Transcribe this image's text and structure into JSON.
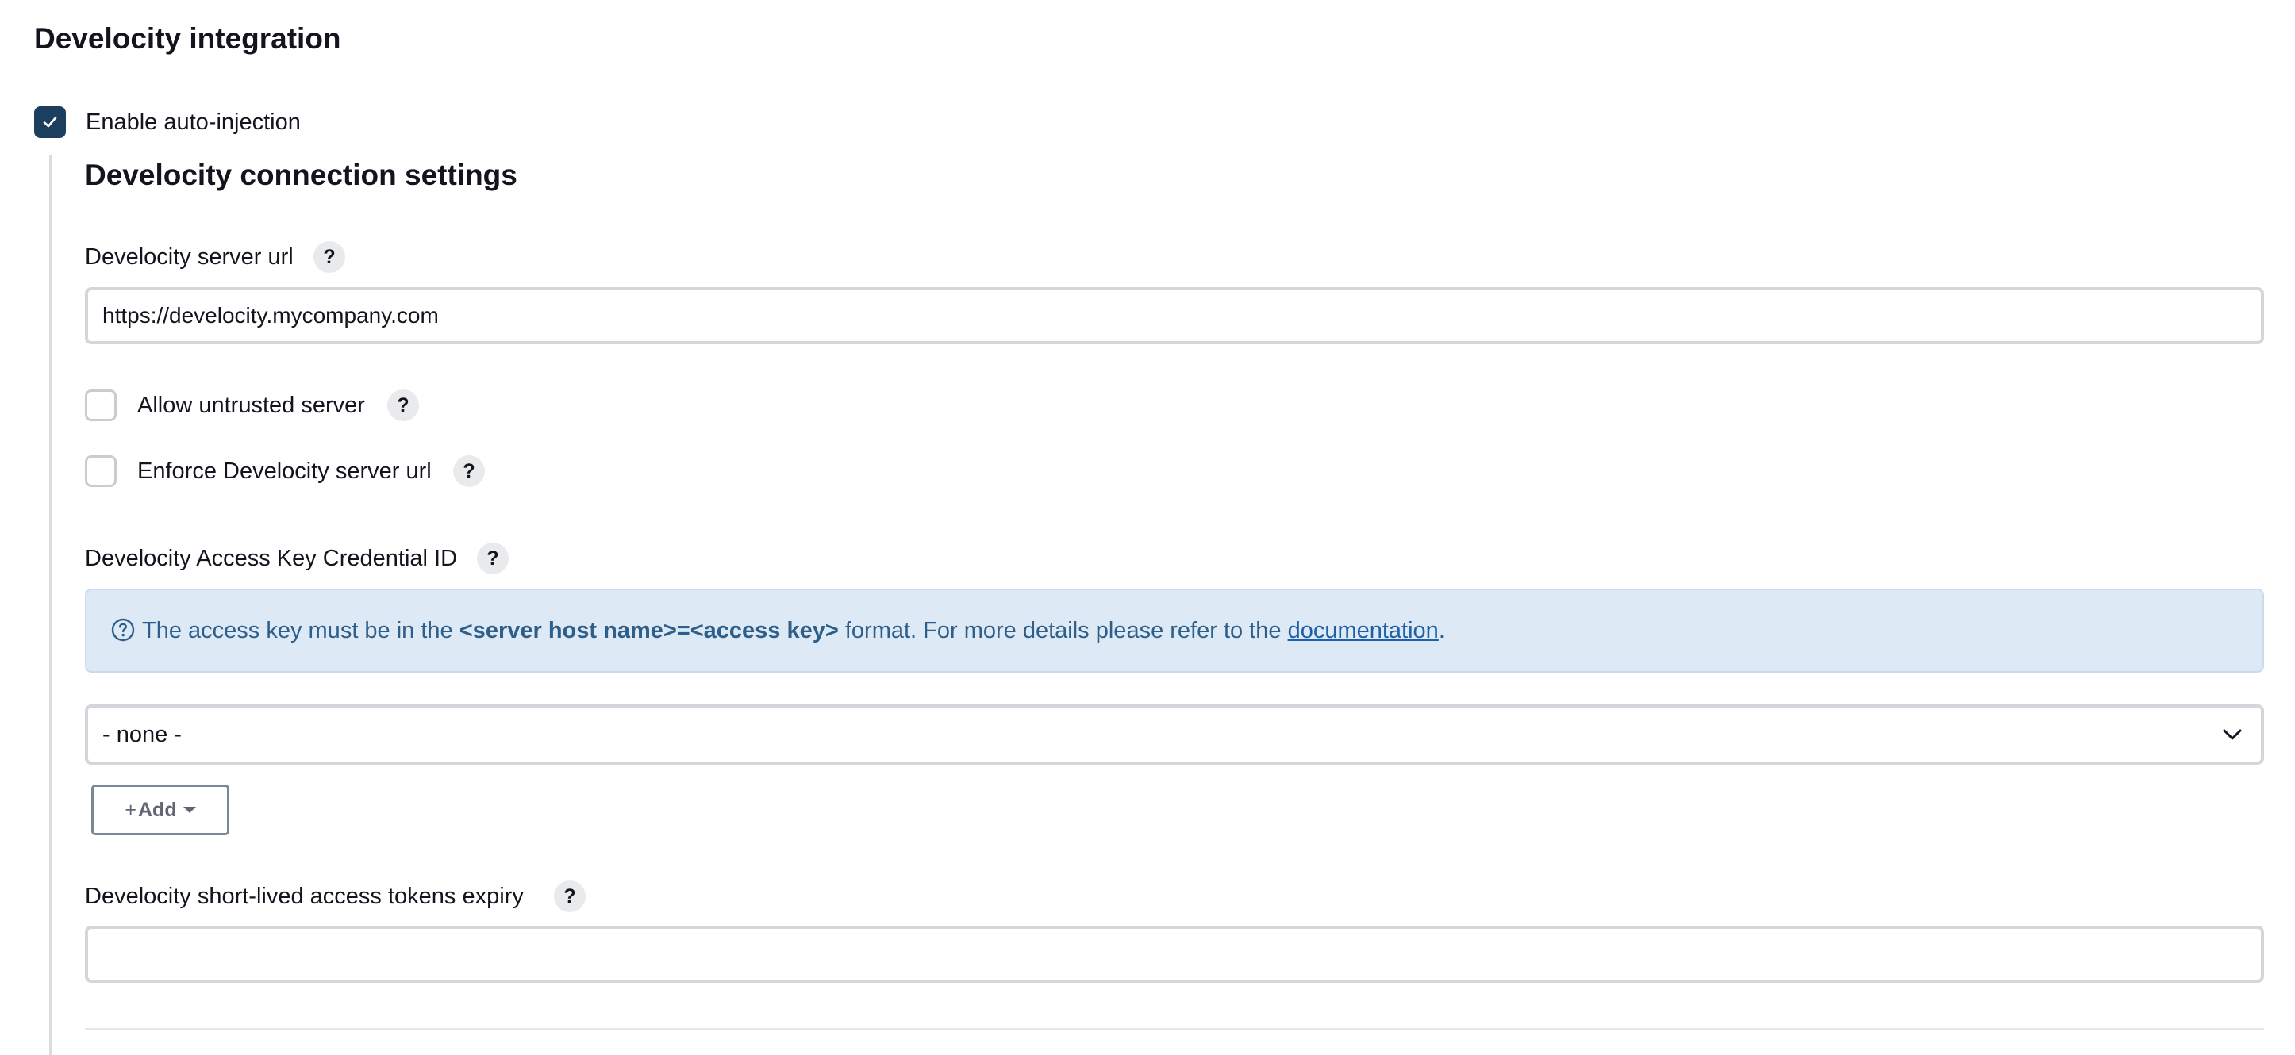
{
  "section": {
    "title": "Develocity integration"
  },
  "auto_injection": {
    "label": "Enable auto-injection",
    "checked": true
  },
  "connection": {
    "title": "Develocity connection settings",
    "server_url": {
      "label": "Develocity server url",
      "help": "?",
      "value": "https://develocity.mycompany.com"
    },
    "allow_untrusted": {
      "label": "Allow untrusted server",
      "help": "?",
      "checked": false
    },
    "enforce_url": {
      "label": "Enforce Develocity server url",
      "help": "?",
      "checked": false
    },
    "credential": {
      "label": "Develocity Access Key Credential ID",
      "help": "?",
      "info_prefix": "The access key must be in the ",
      "info_bold": "<server host name>=<access key>",
      "info_middle": " format. For more details please refer to the ",
      "info_link": "documentation",
      "info_suffix": ".",
      "selected": "- none -",
      "add_label": "Add"
    },
    "token_expiry": {
      "label": "Develocity short-lived access tokens expiry",
      "help": "?",
      "value": ""
    }
  },
  "colors": {
    "checkbox_checked": "#1c3f5e",
    "info_background": "#dde9f4",
    "info_text": "#2e5f8a",
    "link": "#1f5fa8"
  }
}
